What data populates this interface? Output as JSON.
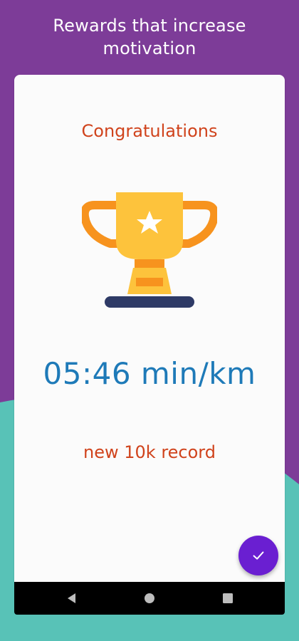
{
  "header": {
    "title_line1": "Rewards that increase",
    "title_line2": "motivation"
  },
  "card": {
    "congrats_text": "Congratulations",
    "trophy_icon": "trophy-icon",
    "pace_value": "05:46 min/km",
    "record_text": "new 10k record"
  },
  "fab": {
    "icon": "checkmark-icon"
  },
  "navigation_bar": {
    "buttons": [
      "back",
      "home",
      "recents"
    ]
  },
  "colors": {
    "purple_background": "#7d3c98",
    "teal_background": "#58c2b7",
    "card_background": "#fbfbfb",
    "accent_orange": "#d0431c",
    "pace_blue": "#1e7ab8",
    "fab_purple": "#6a1fd1",
    "trophy_gold": "#fdc33c",
    "trophy_orange": "#f7931e",
    "trophy_base": "#2e3a66"
  }
}
